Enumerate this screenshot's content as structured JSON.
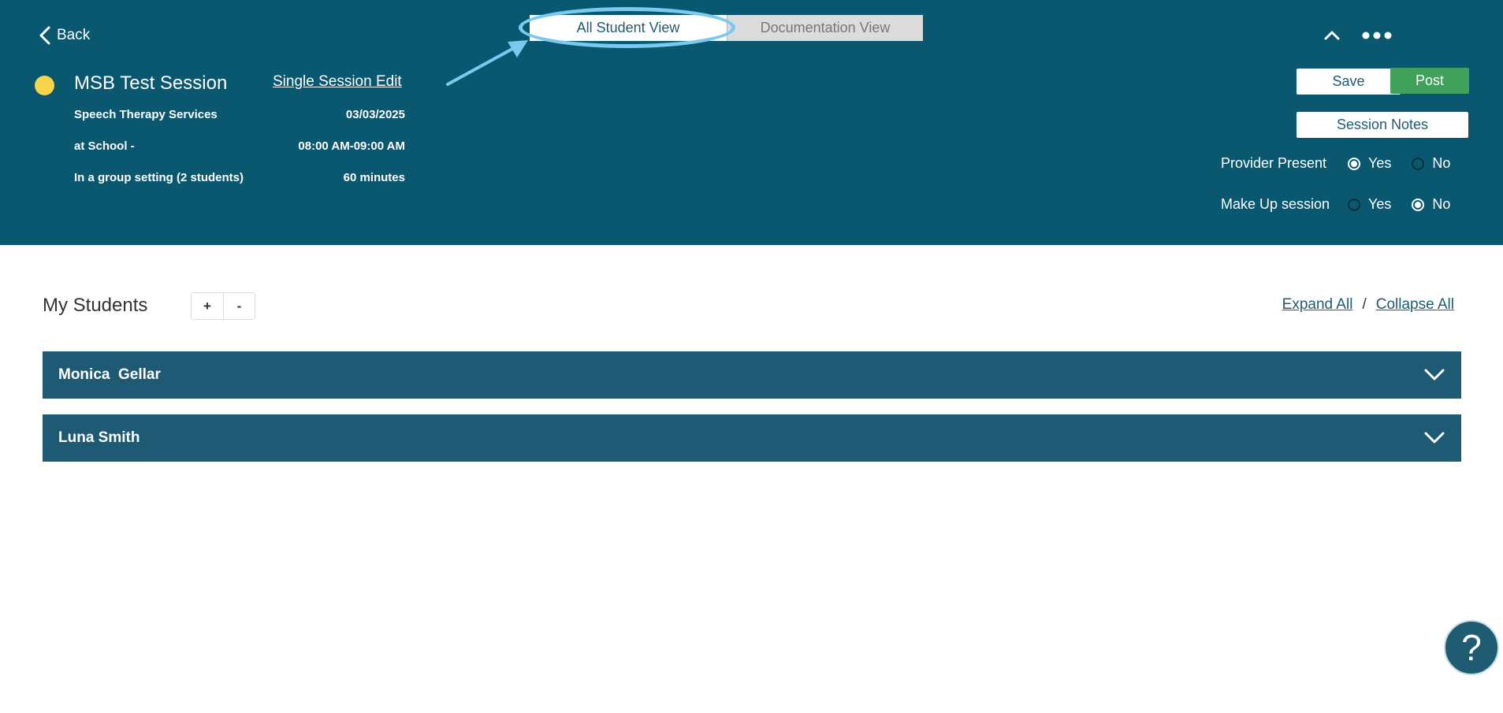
{
  "header": {
    "back_label": "Back",
    "session_title": "MSB Test Session",
    "single_session_edit": "Single Session Edit",
    "status_color": "#f7d448",
    "service": "Speech Therapy Services",
    "date": "03/03/2025",
    "location": "at School -",
    "time_range": "08:00 AM-09:00 AM",
    "setting": "In a group setting (2 students)",
    "duration": "60 minutes"
  },
  "tabs": [
    {
      "label": "All Student View",
      "active": true
    },
    {
      "label": "Documentation View",
      "active": false
    }
  ],
  "actions": {
    "save_label": "Save",
    "post_label": "Post",
    "session_notes_label": "Session Notes"
  },
  "provider_present": {
    "label": "Provider Present",
    "yes_label": "Yes",
    "no_label": "No",
    "selected": "Yes"
  },
  "make_up_session": {
    "label": "Make Up session",
    "yes_label": "Yes",
    "no_label": "No",
    "selected": "No"
  },
  "students_section": {
    "title": "My Students",
    "plus_label": "+",
    "minus_label": "-",
    "expand_all": "Expand All",
    "separator": "/",
    "collapse_all": "Collapse All",
    "students": [
      {
        "name": "Monica  Gellar"
      },
      {
        "name": "Luna Smith"
      }
    ]
  },
  "help_label": "?",
  "colors": {
    "header_bg": "#0a5870",
    "post_green": "#3fa15a",
    "student_row_bg": "#1e5a73",
    "highlight": "#7cc9f0"
  }
}
